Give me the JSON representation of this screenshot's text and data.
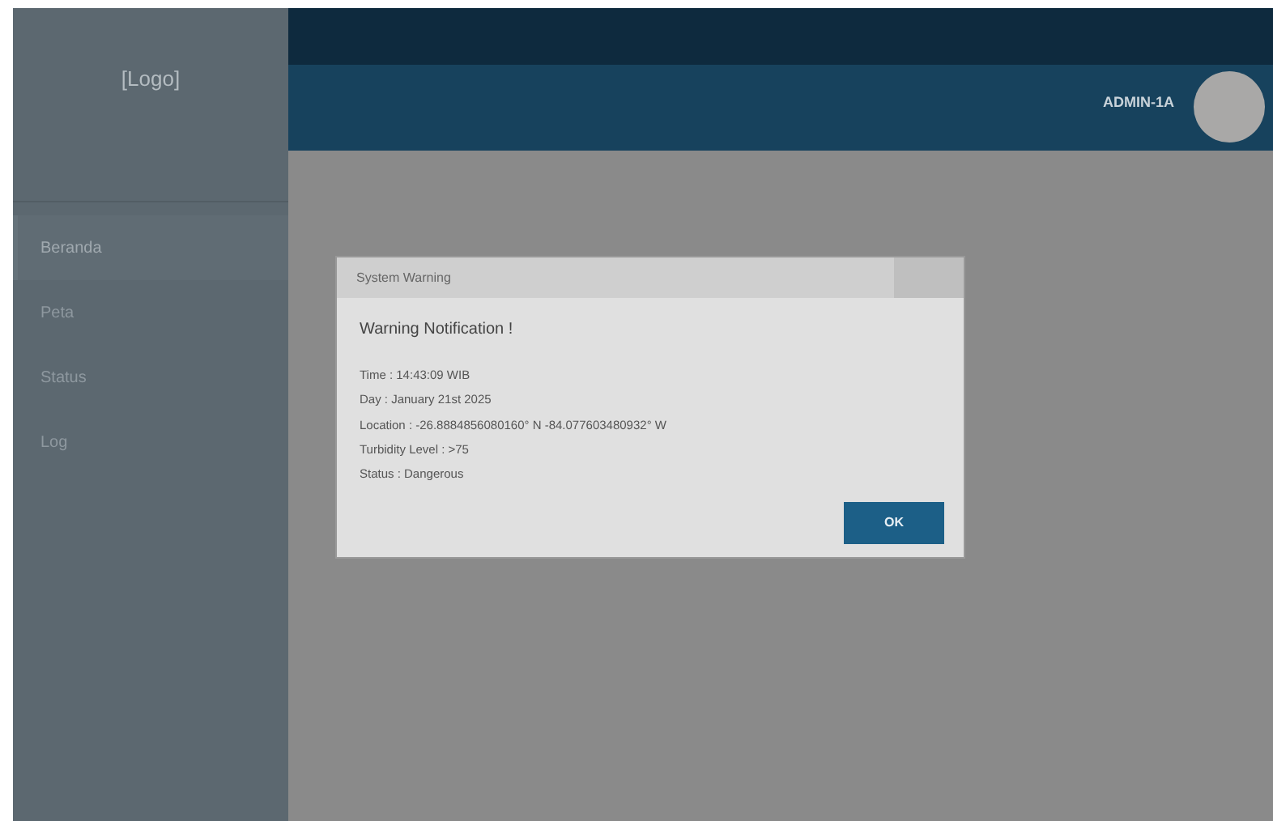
{
  "sidebar": {
    "logo": "[Logo]",
    "items": [
      {
        "label": "Beranda",
        "selected": true
      },
      {
        "label": "Peta",
        "selected": false
      },
      {
        "label": "Status",
        "selected": false
      },
      {
        "label": "Log",
        "selected": false
      }
    ]
  },
  "header": {
    "user": "ADMIN-1A"
  },
  "dialog": {
    "title": "System Warning",
    "heading": "Warning Notification !",
    "lines": [
      "Time : 14:43:09 WIB",
      "Day : January 21st 2025",
      "Location : -26.8884856080160° N -84.077603480932° W",
      "Turbidity Level : >75",
      "Status : Dangerous"
    ],
    "button": "OK"
  }
}
